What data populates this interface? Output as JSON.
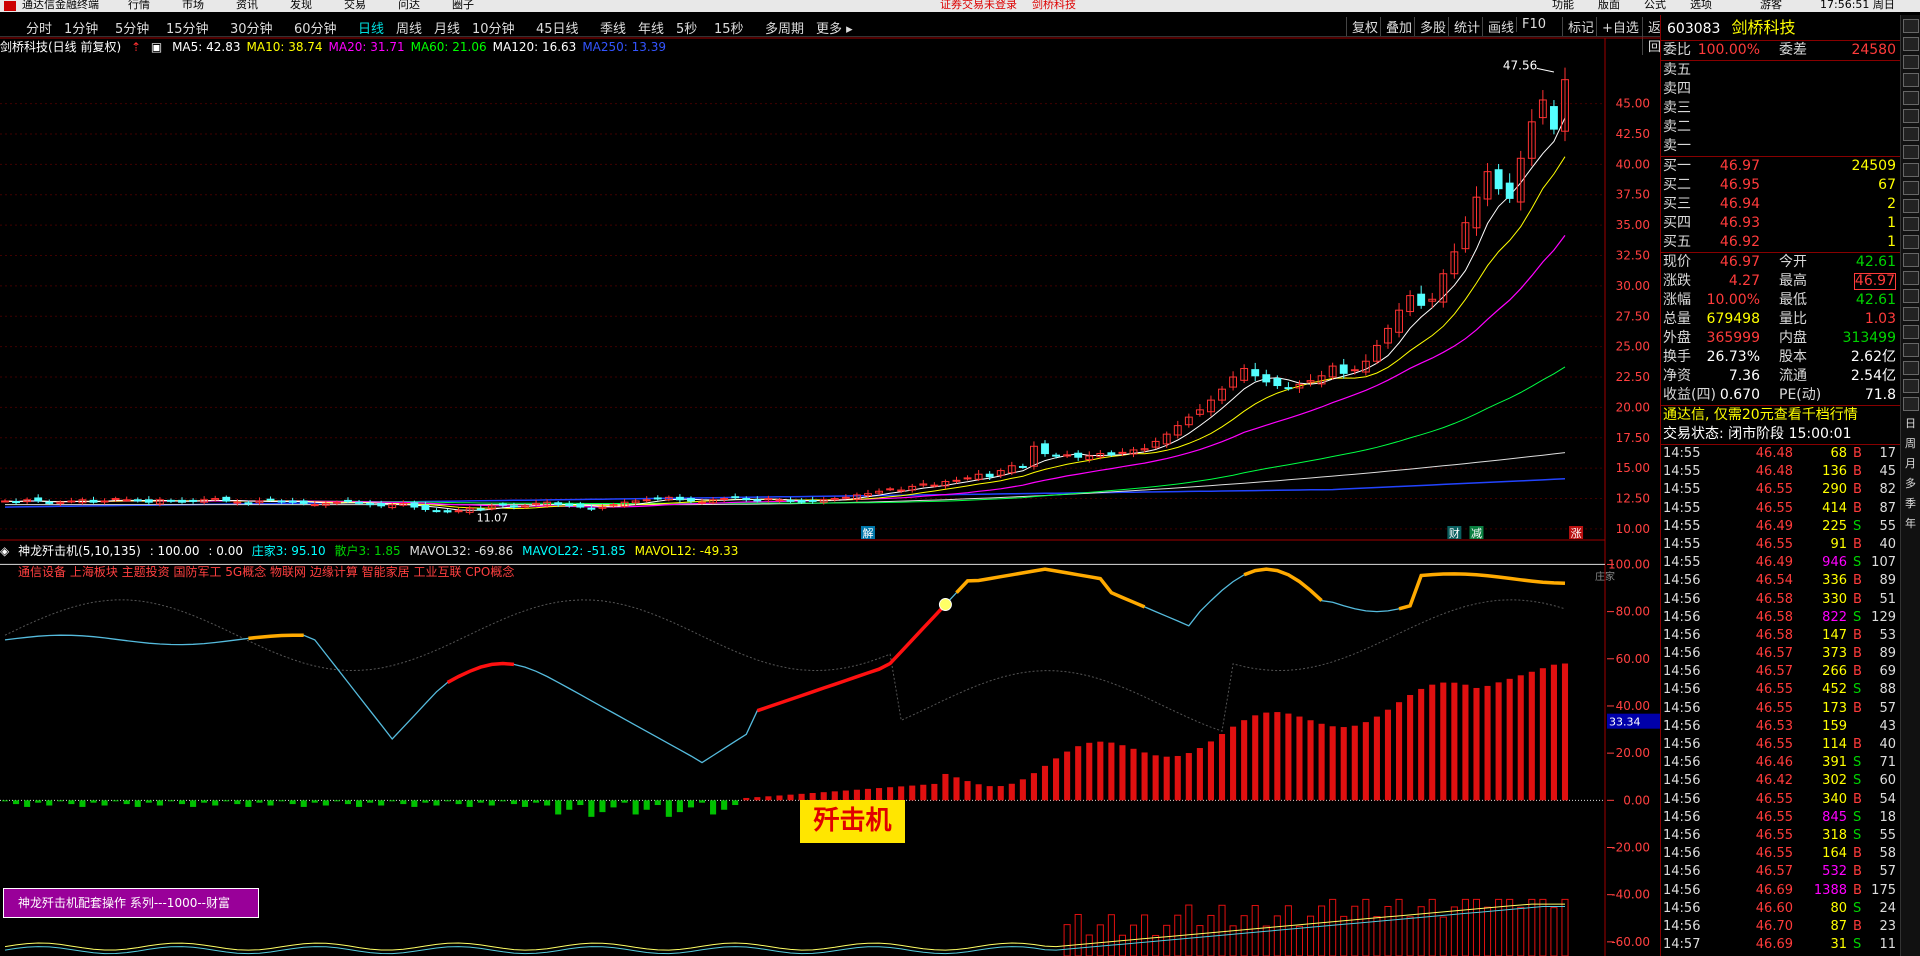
{
  "menu": {
    "items": [
      "通达信金融终端",
      "行情",
      "市场",
      "资讯",
      "发现",
      "交易",
      "问达",
      "圈子"
    ],
    "notice": "证券交易未登录",
    "stock": "剑桥科技",
    "right_items": [
      "功能",
      "版面",
      "公式",
      "选项",
      "游客"
    ],
    "clock": "17:56:51 周日"
  },
  "toolbar": {
    "periods": [
      "分时",
      "1分钟",
      "5分钟",
      "15分钟",
      "30分钟",
      "60分钟",
      "日线",
      "周线",
      "月线",
      "10分钟",
      "45日线",
      "季线",
      "年线",
      "5秒",
      "15秒",
      "多周期",
      "更多"
    ],
    "active": "日线",
    "right": [
      "复权",
      "叠加",
      "多股",
      "统计",
      "画线",
      "F10",
      "标记",
      "+自选",
      "返回"
    ]
  },
  "main_chart": {
    "title": "剑桥科技(日线 前复权)",
    "ma": [
      {
        "label": "MA5: 42.83",
        "color": "#ffffff"
      },
      {
        "label": "MA10: 38.74",
        "color": "#ffff00"
      },
      {
        "label": "MA20: 31.71",
        "color": "#ff00ff"
      },
      {
        "label": "MA60: 21.06",
        "color": "#00ff00"
      },
      {
        "label": "MA120: 16.63",
        "color": "#ffffff"
      },
      {
        "label": "MA250: 13.39",
        "color": "#3355ff"
      }
    ],
    "high_label": "47.56",
    "low_label": "11.07",
    "markers": {
      "m1": "解",
      "m2": "财",
      "m3": "减",
      "m4": "涨"
    }
  },
  "chart_data": {
    "type": "candlestick",
    "title": "剑桥科技(日线 前复权)",
    "y_ticks": [
      10.0,
      12.5,
      15.0,
      17.5,
      20.0,
      22.5,
      25.0,
      27.5,
      30.0,
      32.5,
      35.0,
      37.5,
      40.0,
      42.5,
      45.0
    ],
    "ylim": [
      9.5,
      49
    ],
    "closes": [
      12.3,
      12.2,
      12.4,
      12.3,
      12.1,
      12.2,
      12.3,
      12.4,
      12.2,
      12.3,
      12.5,
      12.4,
      12.3,
      12.2,
      12.4,
      12.3,
      12.2,
      12.3,
      12.4,
      12.5,
      12.3,
      12.2,
      12.1,
      12.3,
      12.4,
      12.3,
      12.2,
      12.1,
      12.0,
      12.1,
      12.2,
      12.3,
      12.1,
      12.0,
      11.9,
      12.0,
      12.1,
      11.8,
      11.6,
      11.5,
      11.4,
      11.5,
      11.7,
      11.6,
      11.9,
      12.0,
      11.8,
      11.9,
      12.1,
      12.2,
      12.0,
      11.9,
      11.8,
      11.7,
      11.8,
      12.0,
      12.2,
      12.3,
      12.4,
      12.5,
      12.6,
      12.4,
      12.3,
      12.2,
      12.4,
      12.5,
      12.6,
      12.4,
      12.3,
      12.5,
      12.4,
      12.3,
      12.2,
      12.3,
      12.4,
      12.5,
      12.6,
      12.8,
      12.9,
      13.1,
      13.3,
      13.2,
      13.5,
      13.7,
      13.6,
      13.9,
      14.0,
      14.2,
      14.5,
      14.3,
      14.8,
      15.2,
      15.1,
      16.8,
      16.2,
      16.0,
      16.1,
      15.9,
      16.0,
      16.2,
      16.1,
      16.3,
      16.5,
      16.6,
      17.2,
      17.8,
      18.5,
      19.2,
      19.8,
      20.6,
      21.5,
      22.5,
      23.2,
      22.6,
      22.1,
      21.8,
      21.6,
      21.9,
      22.2,
      22.6,
      23.4,
      22.8,
      23.1,
      23.8,
      25.1,
      26.5,
      28.0,
      29.2,
      28.4,
      28.9,
      31.0,
      32.8,
      35.2,
      37.3,
      39.4,
      38.0,
      37.2,
      40.5,
      43.5,
      45.3,
      42.9,
      46.97
    ],
    "indicator": {
      "name": "神龙歼击机(5,10,135)",
      "values": {
        "v1": "100.00",
        "v2": "0.00",
        "zhuangjia3": "95.10",
        "sanhu": "1.85",
        "mavol32": "-69.86",
        "mavol22": "-51.85",
        "mavol12": "-49.33"
      },
      "y_ticks": [
        -60.0,
        -40.0,
        -20.0,
        0.0,
        20.0,
        40.0,
        60.0,
        80.0,
        100.0
      ],
      "ylim": [
        -66,
        104
      ],
      "current_value": "33.34",
      "zhuangjia_label": "庄家"
    }
  },
  "indicator_info": {
    "label_name": "神龙歼击机(5,10,135)",
    "v1": ": 100.00",
    "v2": ": 0.00",
    "zj": "庄家3: 95.10",
    "sh": "散户3: 1.85",
    "m32": "MAVOL32: -69.86",
    "m22": "MAVOL22: -51.85",
    "m12": "MAVOL12: -49.33"
  },
  "concepts": "通信设备 上海板块 主题投资 国防军工 5G概念 物联网 边缘计算 智能家居 工业互联 CPO概念",
  "banner": "歼击机",
  "promo": "神龙歼击机配套操作 系列---1000--财富",
  "quote": {
    "code": "603083",
    "name": "剑桥科技",
    "weibi_label": "委比",
    "weibi": "100.00%",
    "weicha_label": "委差",
    "weicha": "24580",
    "sell": [
      "卖五",
      "卖四",
      "卖三",
      "卖二",
      "卖一"
    ],
    "buy": [
      {
        "label": "买一",
        "price": "46.97",
        "vol": "24509"
      },
      {
        "label": "买二",
        "price": "46.95",
        "vol": "67"
      },
      {
        "label": "买三",
        "price": "46.94",
        "vol": "2"
      },
      {
        "label": "买四",
        "price": "46.93",
        "vol": "1"
      },
      {
        "label": "买五",
        "price": "46.92",
        "vol": "1"
      }
    ],
    "stats": [
      {
        "l": "现价",
        "m": "46.97",
        "mc": "red",
        "l2": "今开",
        "r": "42.61",
        "rc": "green"
      },
      {
        "l": "涨跌",
        "m": "4.27",
        "mc": "red",
        "l2": "最高",
        "r": "46.97",
        "rc": "red"
      },
      {
        "l": "涨幅",
        "m": "10.00%",
        "mc": "red",
        "l2": "最低",
        "r": "42.61",
        "rc": "green"
      },
      {
        "l": "总量",
        "m": "679498",
        "mc": "yellow",
        "l2": "量比",
        "r": "1.03",
        "rc": "red"
      },
      {
        "l": "外盘",
        "m": "365999",
        "mc": "red",
        "l2": "内盘",
        "r": "313499",
        "rc": "green"
      },
      {
        "l": "换手",
        "m": "26.73%",
        "mc": "white",
        "l2": "股本",
        "r": "2.62亿",
        "rc": "white"
      },
      {
        "l": "净资",
        "m": "7.36",
        "mc": "white",
        "l2": "流通",
        "r": "2.54亿",
        "rc": "white"
      },
      {
        "l": "收益(四)",
        "m": "0.670",
        "mc": "white",
        "l2": "PE(动)",
        "r": "71.8",
        "rc": "white"
      }
    ],
    "promo": "通达信, 仅需20元查看千档行情",
    "trade_state": "交易状态: 闭市阶段 15:00:01"
  },
  "ticks": [
    [
      "14:55",
      "46.48",
      "68",
      "B",
      "17"
    ],
    [
      "14:55",
      "46.48",
      "136",
      "B",
      "45"
    ],
    [
      "14:55",
      "46.55",
      "290",
      "B",
      "82"
    ],
    [
      "14:55",
      "46.55",
      "414",
      "B",
      "87"
    ],
    [
      "14:55",
      "46.49",
      "225",
      "S",
      "55"
    ],
    [
      "14:55",
      "46.55",
      "91",
      "B",
      "40"
    ],
    [
      "14:55",
      "46.49",
      "946",
      "S",
      "107"
    ],
    [
      "14:56",
      "46.54",
      "336",
      "B",
      "89"
    ],
    [
      "14:56",
      "46.58",
      "330",
      "B",
      "51"
    ],
    [
      "14:56",
      "46.58",
      "822",
      "S",
      "129"
    ],
    [
      "14:56",
      "46.58",
      "147",
      "B",
      "53"
    ],
    [
      "14:56",
      "46.57",
      "373",
      "B",
      "89"
    ],
    [
      "14:56",
      "46.57",
      "266",
      "B",
      "69"
    ],
    [
      "14:56",
      "46.55",
      "452",
      "S",
      "88"
    ],
    [
      "14:56",
      "46.55",
      "173",
      "B",
      "57"
    ],
    [
      "14:56",
      "46.53",
      "159",
      "",
      "43"
    ],
    [
      "14:56",
      "46.55",
      "114",
      "B",
      "40"
    ],
    [
      "14:56",
      "46.46",
      "391",
      "S",
      "71"
    ],
    [
      "14:56",
      "46.42",
      "302",
      "S",
      "60"
    ],
    [
      "14:56",
      "46.55",
      "340",
      "B",
      "54"
    ],
    [
      "14:56",
      "46.55",
      "845",
      "S",
      "18"
    ],
    [
      "14:56",
      "46.55",
      "318",
      "S",
      "55"
    ],
    [
      "14:56",
      "46.55",
      "164",
      "B",
      "58"
    ],
    [
      "14:56",
      "46.57",
      "532",
      "B",
      "57"
    ],
    [
      "14:56",
      "46.69",
      "1388",
      "B",
      "175"
    ],
    [
      "14:56",
      "46.60",
      "80",
      "S",
      "24"
    ],
    [
      "14:56",
      "46.70",
      "87",
      "B",
      "23"
    ],
    [
      "14:57",
      "46.69",
      "31",
      "S",
      "11"
    ]
  ],
  "side_chars": [
    "日",
    "周",
    "月",
    "多",
    "季",
    "年"
  ]
}
